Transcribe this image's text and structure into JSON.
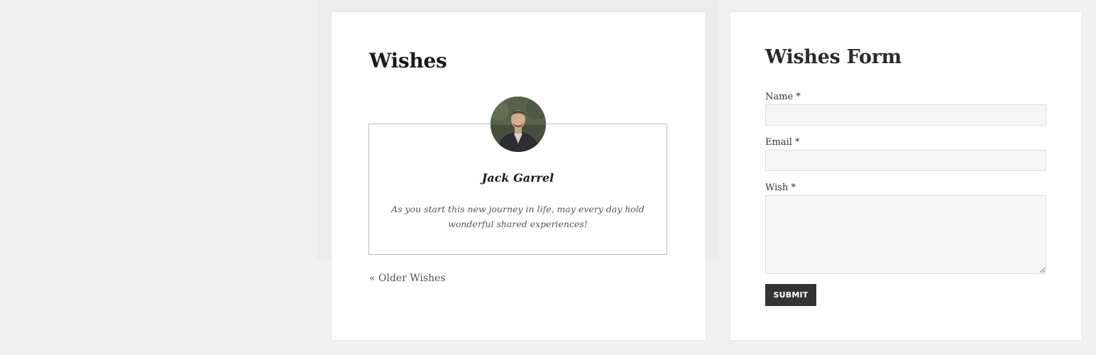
{
  "wishes": {
    "title": "Wishes",
    "entry": {
      "name": "Jack Garrel",
      "text": "As you start this new journey in life, may every day hold wonderful shared experiences!",
      "avatar_icon": "person-photo-avatar"
    },
    "older_link": "« Older Wishes"
  },
  "form": {
    "title": "Wishes Form",
    "fields": {
      "name_label": "Name *",
      "name_value": "",
      "email_label": "Email *",
      "email_value": "",
      "wish_label": "Wish *",
      "wish_value": ""
    },
    "submit_label": "SUBMIT"
  },
  "colors": {
    "page_bg": "#f1f1f1",
    "panel_bg": "#ffffff",
    "input_bg": "#f7f7f7",
    "button_bg": "#333333",
    "button_text": "#ffffff"
  }
}
